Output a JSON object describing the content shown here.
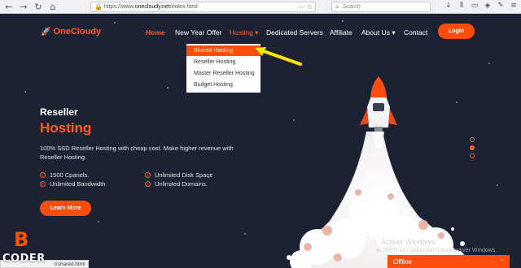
{
  "browser": {
    "url_prefix": "https://www.",
    "url_domain": "onecloudy.net",
    "url_path": "/index.html",
    "search_placeholder": "Search",
    "status_url": "t/shared.html"
  },
  "site": {
    "logo_text": "OneCloudy",
    "nav": {
      "home": "Home",
      "offer": "New Year Offer",
      "hosting": "Hosting ▾",
      "dedicated": "Dedicated Servers",
      "affiliate": "Affiliate",
      "about": "About Us ▾",
      "contact": "Contact"
    },
    "login_label": "Login",
    "dropdown": [
      "Shared Hosting",
      "Reseller Hosting",
      "Master Reseller Hosting",
      "Budget Hosting"
    ],
    "hero": {
      "subtitle": "Reseller",
      "title": "Hosting",
      "description": "100% SSD Reseller Hosting with cheap cost. Make higher revenue with Reseller Hosting.",
      "features": [
        "1500 Cpanels.",
        "Unlimited Disk Space",
        "Unlimited Bandwidth",
        "Unlimited Domains."
      ],
      "cta": "Learn More"
    },
    "accent_color": "#ff4d0d",
    "background_color": "#1c2233"
  },
  "overlay": {
    "watermark_title": "Activer Windows",
    "watermark_sub": "Accédez aux paramètres pour activer Windows.",
    "badge_letter": "B",
    "badge_word": "CODER",
    "chat_status": "Offline"
  }
}
